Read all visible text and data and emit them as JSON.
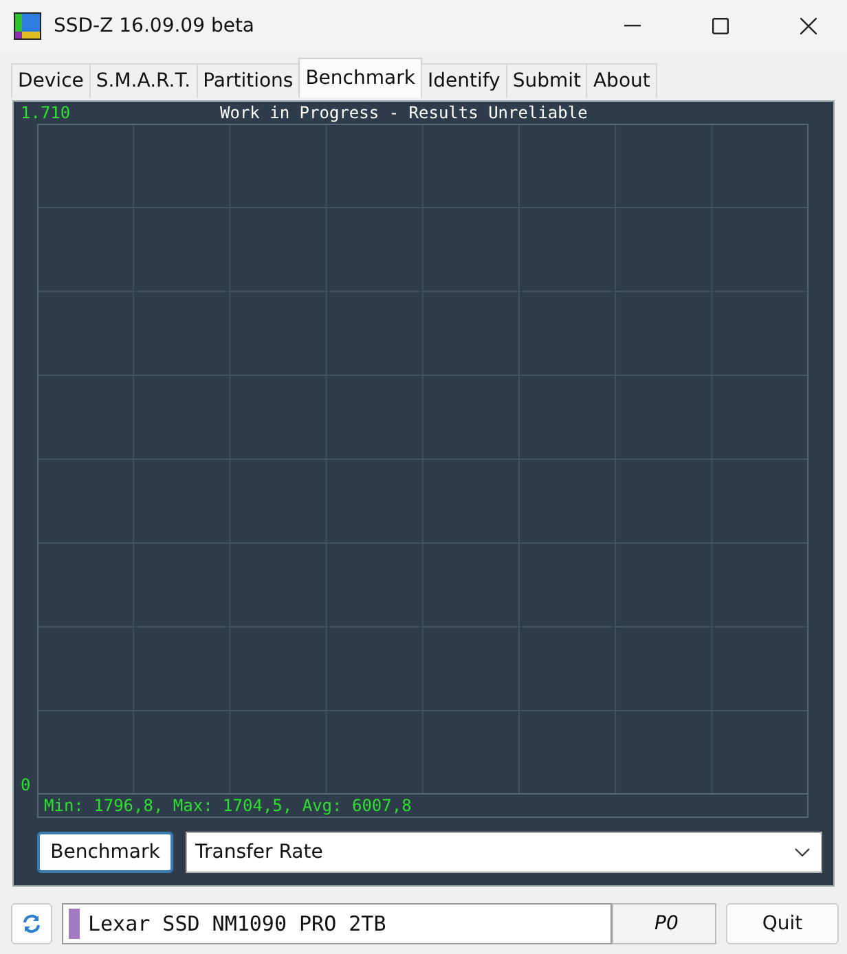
{
  "window": {
    "title": "SSD-Z 16.09.09 beta"
  },
  "tabs": [
    {
      "label": "Device",
      "selected": false
    },
    {
      "label": "S.M.A.R.T.",
      "selected": false
    },
    {
      "label": "Partitions",
      "selected": false
    },
    {
      "label": "Benchmark",
      "selected": true
    },
    {
      "label": "Identify",
      "selected": false
    },
    {
      "label": "Submit",
      "selected": false
    },
    {
      "label": "About",
      "selected": false
    }
  ],
  "graph": {
    "y_max": "1.710",
    "y_min": "0",
    "title": "Work in Progress - Results Unreliable",
    "stats": "Min: 1796,8, Max: 1704,5, Avg: 6007,8"
  },
  "benchmark_button": "Benchmark",
  "mode_select": {
    "value": "Transfer Rate"
  },
  "status_bar": {
    "drive": {
      "name": "Lexar SSD NM1090 PRO 2TB",
      "color": "#a07cc0"
    },
    "partition": "P0",
    "quit": "Quit"
  }
}
